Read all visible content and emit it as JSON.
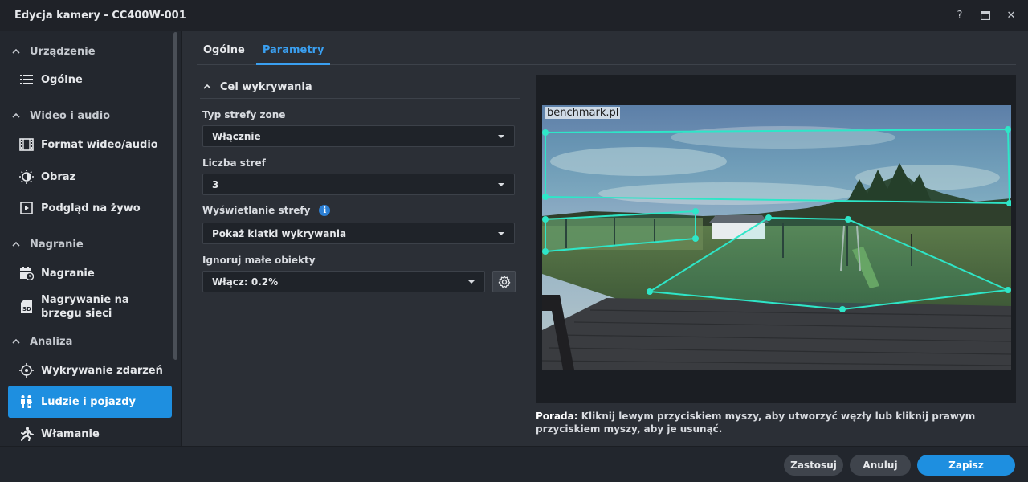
{
  "window": {
    "title": "Edycja kamery - CC400W-001",
    "controls": {
      "help": "?",
      "maximize_icon": "maximize-icon",
      "close": "✕"
    }
  },
  "sidebar": {
    "sections": [
      {
        "label": "Urządzenie"
      },
      {
        "label": "Wideo i audio"
      },
      {
        "label": "Nagranie"
      },
      {
        "label": "Analiza"
      }
    ],
    "items": [
      {
        "label": "Ogólne",
        "icon": "list-icon"
      },
      {
        "label": "Format wideo/audio",
        "icon": "film-icon"
      },
      {
        "label": "Obraz",
        "icon": "brightness-icon"
      },
      {
        "label": "Podgląd na żywo",
        "icon": "live-view-icon"
      },
      {
        "label": "Nagranie",
        "icon": "calendar-clock-icon"
      },
      {
        "label": "Nagrywanie na brzegu sieci",
        "icon": "sd-card-icon"
      },
      {
        "label": "Wykrywanie zdarzeń",
        "icon": "crosshair-icon"
      },
      {
        "label": "Ludzie i pojazdy",
        "icon": "person-vehicle-icon",
        "active": true
      },
      {
        "label": "Włamanie",
        "icon": "intrusion-icon"
      }
    ]
  },
  "tabs": [
    {
      "label": "Ogólne",
      "active": false
    },
    {
      "label": "Parametry",
      "active": true
    }
  ],
  "form": {
    "section_title": "Cel wykrywania",
    "zone_type": {
      "label": "Typ strefy zone",
      "value": "Włącznie"
    },
    "zone_count": {
      "label": "Liczba stref",
      "value": "3"
    },
    "zone_display": {
      "label": "Wyświetlanie strefy",
      "value": "Pokaż klatki wykrywania",
      "info": "i"
    },
    "ignore_small": {
      "label": "Ignoruj małe obiekty",
      "value": "Włącz: 0.2%"
    }
  },
  "preview": {
    "watermark": "benchmark.pl"
  },
  "tip": {
    "prefix": "Porada:",
    "text": "Kliknij lewym przyciskiem myszy, aby utworzyć węzły lub kliknij prawym przyciskiem myszy, aby je usunąć."
  },
  "footer": {
    "apply": "Zastosuj",
    "cancel": "Anuluj",
    "save": "Zapisz"
  },
  "colors": {
    "accent": "#1e8fe0",
    "zone": "#2ee6c8"
  }
}
